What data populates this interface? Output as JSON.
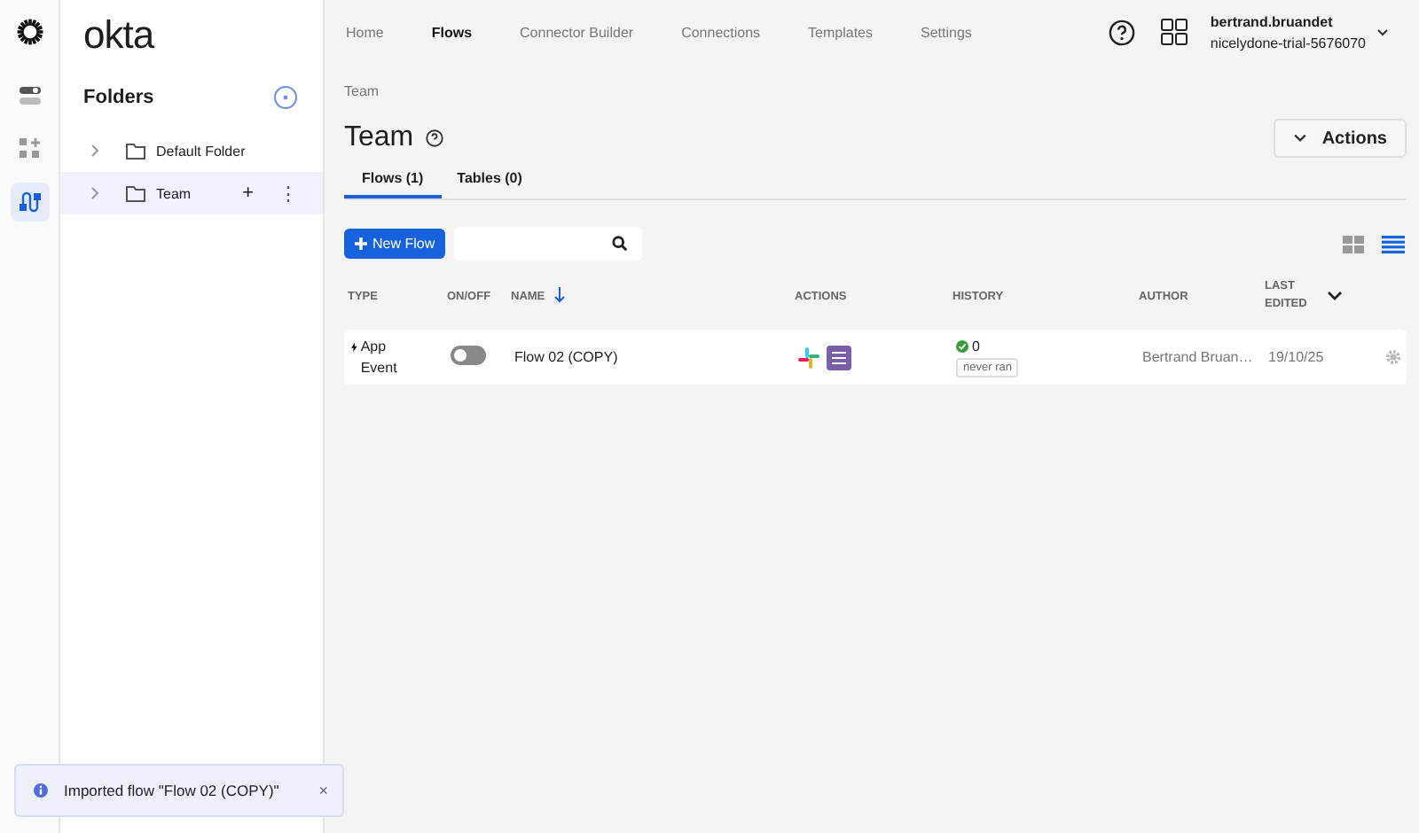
{
  "brand": "okta",
  "rail": [
    {
      "kind": "toggles",
      "selected": false
    },
    {
      "kind": "apps",
      "selected": false
    },
    {
      "kind": "flows",
      "selected": true
    }
  ],
  "sidebar": {
    "title": "Folders",
    "folders": [
      {
        "name": "Default Folder",
        "selected": false
      },
      {
        "name": "Team",
        "selected": true
      }
    ],
    "add_symbol": "+",
    "more_symbol": "⋮"
  },
  "nav": [
    {
      "label": "Home",
      "selected": false
    },
    {
      "label": "Flows",
      "selected": true
    },
    {
      "label": "Connector Builder",
      "selected": false
    },
    {
      "label": "Connections",
      "selected": false
    },
    {
      "label": "Templates",
      "selected": false
    },
    {
      "label": "Settings",
      "selected": false
    }
  ],
  "user": {
    "name": "bertrand.bruandet",
    "org": "nicelydone-trial-5676070"
  },
  "breadcrumb": "Team",
  "page_title": "Team",
  "actions_button": "Actions",
  "tabs": [
    {
      "label": "Flows (1)",
      "selected": true
    },
    {
      "label": "Tables (0)",
      "selected": false
    }
  ],
  "new_flow_button": "New Flow",
  "view": {
    "grid_selected": false,
    "list_selected": true
  },
  "table": {
    "columns": [
      "TYPE",
      "ON/OFF",
      "NAME",
      "ACTIONS",
      "HISTORY",
      "AUTHOR",
      "LAST EDITED"
    ],
    "rows": [
      {
        "type": "App Event",
        "on": false,
        "name": "Flow 02 (COPY)",
        "history_count": "0",
        "history_note": "never ran",
        "author": "Bertrand Bruan…",
        "edited": "19/10/25"
      }
    ]
  },
  "toast": {
    "message": "Imported flow \"Flow 02 (COPY)\"",
    "close": "×"
  }
}
